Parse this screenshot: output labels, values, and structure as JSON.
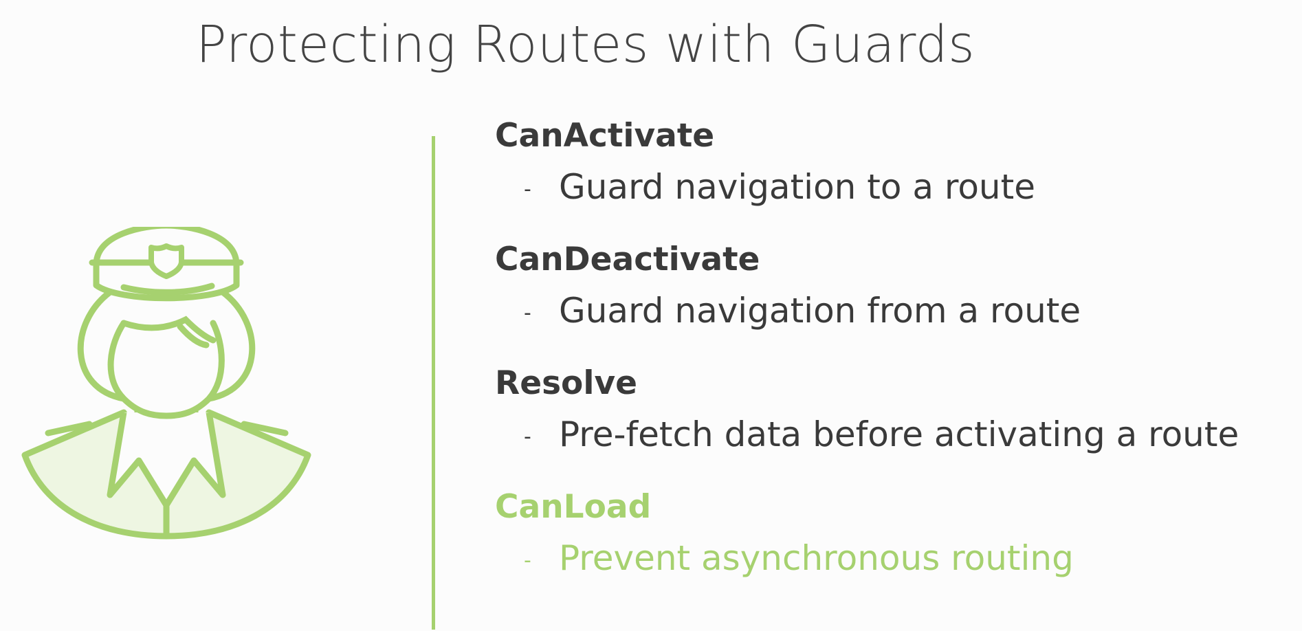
{
  "slide": {
    "title": "Protecting Routes with Guards",
    "illustration_icon": "police-officer-icon",
    "colors": {
      "accent": "#a6d16f",
      "text": "#3a3a3a",
      "background": "#fcfcfc"
    },
    "guards": [
      {
        "name": "CanActivate",
        "bullet": "-",
        "description": "Guard navigation to a route",
        "highlighted": false
      },
      {
        "name": "CanDeactivate",
        "bullet": "-",
        "description": "Guard navigation from a route",
        "highlighted": false
      },
      {
        "name": "Resolve",
        "bullet": "-",
        "description": "Pre-fetch data before activating a route",
        "highlighted": false
      },
      {
        "name": "CanLoad",
        "bullet": "-",
        "description": "Prevent asynchronous routing",
        "highlighted": true
      }
    ]
  }
}
